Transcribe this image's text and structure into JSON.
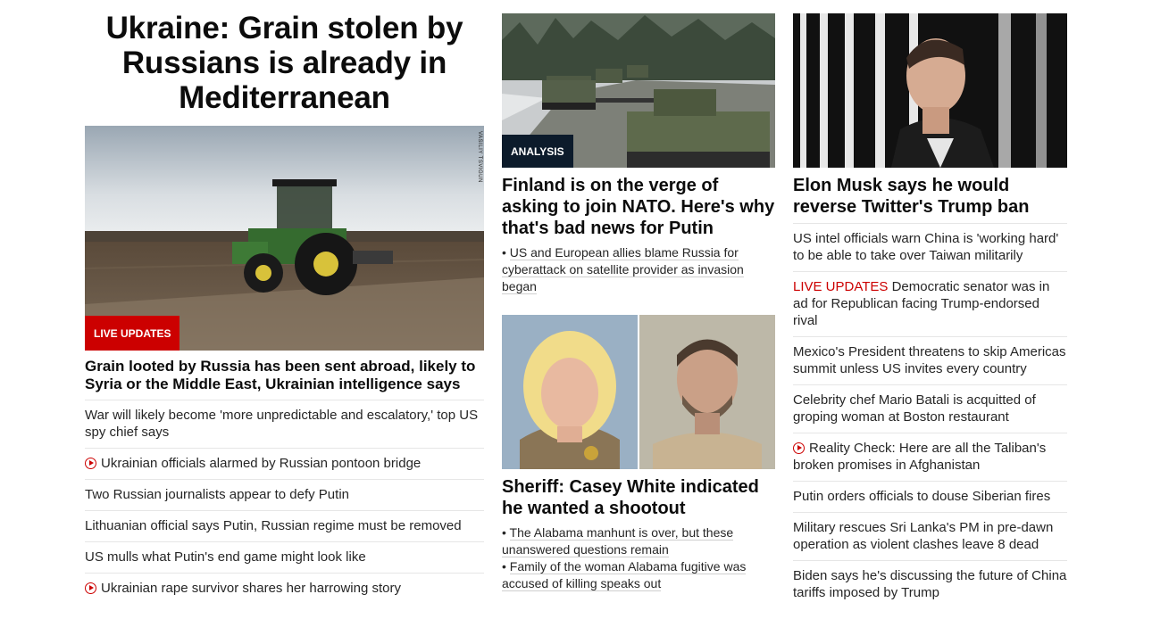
{
  "col1": {
    "headline": "Ukraine: Grain stolen by Russians is already in Mediterranean",
    "image_credit": "VASILIY TSVIGUN",
    "badge": "LIVE UPDATES",
    "lead": "Grain looted by Russia has been sent abroad, likely to Syria or the Middle East, Ukrainian intelligence says",
    "items": [
      {
        "text": "War will likely become 'more unpredictable and escalatory,' top US spy chief says",
        "video": false
      },
      {
        "text": "Ukrainian officials alarmed by Russian pontoon bridge",
        "video": true
      },
      {
        "text": "Two Russian journalists appear to defy Putin",
        "video": false
      },
      {
        "text": "Lithuanian official says Putin, Russian regime must be removed",
        "video": false
      },
      {
        "text": "US mulls what Putin's end game might look like",
        "video": false
      },
      {
        "text": "Ukrainian rape survivor shares her harrowing story",
        "video": true
      }
    ]
  },
  "col2": {
    "story1": {
      "badge": "ANALYSIS",
      "headline": "Finland is on the verge of asking to join NATO. Here's why that's bad news for Putin",
      "bullets": [
        "US and European allies blame Russia for cyberattack on satellite provider as invasion began"
      ]
    },
    "story2": {
      "headline": "Sheriff: Casey White indicated he wanted a shootout",
      "bullets": [
        "The Alabama manhunt is over, but these unanswered questions remain",
        "Family of the woman Alabama fugitive was accused of killing speaks out"
      ]
    }
  },
  "col3": {
    "headline": "Elon Musk says he would reverse Twitter's Trump ban",
    "items": [
      {
        "text": "US intel officials warn China is 'working hard' to be able to take over Taiwan militarily",
        "live": "",
        "video": false
      },
      {
        "text": "Democratic senator was in ad for Republican facing Trump-endorsed rival",
        "live": "LIVE UPDATES",
        "video": false
      },
      {
        "text": "Mexico's President threatens to skip Americas summit unless US invites every country",
        "live": "",
        "video": false
      },
      {
        "text": "Celebrity chef Mario Batali is acquitted of groping woman at Boston restaurant",
        "live": "",
        "video": false
      },
      {
        "text": "Reality Check: Here are all the Taliban's broken promises in Afghanistan",
        "live": "",
        "video": true
      },
      {
        "text": "Putin orders officials to douse Siberian fires",
        "live": "",
        "video": false
      },
      {
        "text": "Military rescues Sri Lanka's PM in pre-dawn operation as violent clashes leave 8 dead",
        "live": "",
        "video": false
      },
      {
        "text": "Biden says he's discussing the future of China tariffs imposed by Trump",
        "live": "",
        "video": false
      }
    ]
  }
}
